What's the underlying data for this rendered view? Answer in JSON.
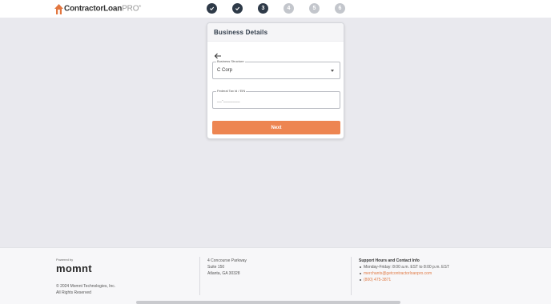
{
  "brand": {
    "name_main": "ContractorLoan",
    "name_suffix": "PRO",
    "mark": "®",
    "logo_icon": "house-roof-icon",
    "accent": "#ed8551"
  },
  "steps": [
    {
      "label": "",
      "state": "done",
      "icon": "check-icon"
    },
    {
      "label": "",
      "state": "done",
      "icon": "check-icon"
    },
    {
      "label": "3",
      "state": "current"
    },
    {
      "label": "4",
      "state": "future"
    },
    {
      "label": "5",
      "state": "future"
    },
    {
      "label": "6",
      "state": "future"
    }
  ],
  "card": {
    "title": "Business Details",
    "back_icon": "arrow-left-icon",
    "business_structure": {
      "label": "Business Structure",
      "value": "C Corp",
      "icon": "caret-down-icon"
    },
    "federal_tax_id": {
      "label": "Federal Tax Id / EIN",
      "placeholder": "__-_______"
    },
    "next_label": "Next"
  },
  "footer": {
    "powered_by": "Powered by",
    "company_logo": "momnt",
    "copyright": "© 2024 Momnt Technologies, Inc.",
    "rights": "All Rights Reserved",
    "address": {
      "line1": "4 Concourse Parkway",
      "line2": "Suite 150",
      "line3": "Atlanta, GA 30328"
    },
    "support": {
      "heading": "Support Hours and Contact Info",
      "hours": "Monday-Friday: 8:00 a.m. EST to 8:00 p.m. EST",
      "email": "merchants@getcontractorloanpro.com",
      "phone": "(800) 475-3871"
    }
  }
}
